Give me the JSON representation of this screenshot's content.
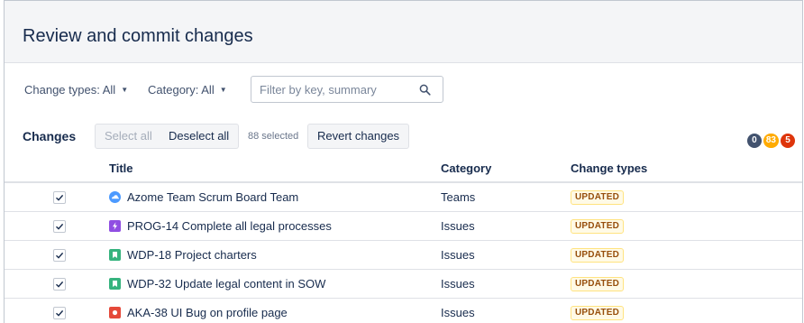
{
  "page": {
    "title": "Review and commit changes"
  },
  "filters": {
    "change_types": "Change types: All",
    "category": "Category: All",
    "search_placeholder": "Filter by key, summary",
    "search_value": ""
  },
  "toolbar": {
    "title": "Changes",
    "select_all": "Select all",
    "deselect_all": "Deselect all",
    "selected_count": "88 selected",
    "revert": "Revert changes"
  },
  "badges": [
    {
      "value": "0",
      "color": "#42526e"
    },
    {
      "value": "83",
      "color": "#ffab00"
    },
    {
      "value": "5",
      "color": "#de350b"
    }
  ],
  "table": {
    "headers": {
      "title": "Title",
      "category": "Category",
      "change_types": "Change types"
    },
    "rows": [
      {
        "checked": true,
        "icon": "team-icon",
        "icon_color": "#4c9aff",
        "title": "Azome Team Scrum Board Team",
        "category": "Teams",
        "change": "UPDATED"
      },
      {
        "checked": true,
        "icon": "epic-icon",
        "icon_color": "#904ee2",
        "title": "PROG-14  Complete all legal processes",
        "category": "Issues",
        "change": "UPDATED"
      },
      {
        "checked": true,
        "icon": "story-icon",
        "icon_color": "#36b37e",
        "title": "WDP-18  Project charters",
        "category": "Issues",
        "change": "UPDATED"
      },
      {
        "checked": true,
        "icon": "story-icon",
        "icon_color": "#36b37e",
        "title": "WDP-32  Update legal content in SOW",
        "category": "Issues",
        "change": "UPDATED"
      },
      {
        "checked": true,
        "icon": "bug-icon",
        "icon_color": "#e5493a",
        "title": "AKA-38  UI Bug on profile page",
        "category": "Issues",
        "change": "UPDATED"
      }
    ]
  }
}
